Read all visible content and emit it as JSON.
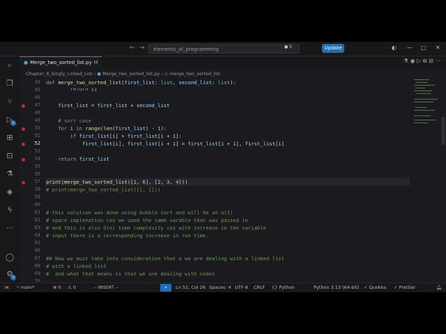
{
  "titlebar": {
    "search_text": "elements_of_programming",
    "search_extra": "● 5",
    "update_label": "Update"
  },
  "tab": {
    "label": "Merge_two_sorted_list.py",
    "modified_marker": "M",
    "close": "×"
  },
  "breadcrumbs": {
    "folder": "Chapter_8_Singly_Linked_List",
    "file": "Merge_two_sorted_list.py",
    "symbol": "merge_two_sorted_list"
  },
  "code": [
    {
      "num": "38",
      "text": ""
    },
    {
      "num": "45",
      "text": ""
    },
    {
      "num": "46",
      "text": ""
    },
    {
      "num": "47",
      "text": ""
    },
    {
      "num": "48",
      "text": ""
    },
    {
      "num": "49",
      "text": ""
    },
    {
      "num": "50",
      "text": ""
    },
    {
      "num": "51",
      "text": ""
    },
    {
      "num": "52",
      "text": ""
    },
    {
      "num": "53",
      "text": ""
    },
    {
      "num": "54",
      "text": ""
    },
    {
      "num": "55",
      "text": ""
    },
    {
      "num": "56",
      "text": ""
    },
    {
      "num": "57",
      "text": ""
    },
    {
      "num": "58",
      "text": "# print(merge_two_sorted_list([], []))"
    },
    {
      "num": "59",
      "text": ""
    },
    {
      "num": "60",
      "text": ""
    },
    {
      "num": "61",
      "text": "# this solution was done using bubble sort and will be an o(1)"
    },
    {
      "num": "62",
      "text": "# space implenation coz we used the same varable that was passed in"
    },
    {
      "num": "63",
      "text": "# and this is also O(n) time complexity coz with increase in the variable"
    },
    {
      "num": "64",
      "text": "# input there is a corresponding increase in run time."
    },
    {
      "num": "65",
      "text": ""
    },
    {
      "num": "66",
      "text": ""
    },
    {
      "num": "67",
      "text": "## Now we must take into consideration that a we are dealing with a linked list"
    },
    {
      "num": "68",
      "text": "# with a linked list"
    },
    {
      "num": "69",
      "text": "#  and what that means is that we are dealing with nodes"
    },
    {
      "num": "70",
      "text": ""
    }
  ],
  "status": {
    "branch": "main*",
    "errors": "⊗ 0",
    "warnings": "⚠ 0",
    "mode": "-- INSERT --",
    "position": "Ln 52, Col 26",
    "spaces": "Spaces: 4",
    "encoding": "UTF-8",
    "eol": "CRLF",
    "language": "Python",
    "interpreter": "Python 3.13 (64-bit)",
    "quokka": "Quokka",
    "prettier": "Prettier"
  },
  "icons": {
    "explorer": "files-icon",
    "search": "search-icon",
    "source_control": "source-control-icon",
    "run_debug": "run-debug-icon",
    "extensions": "extensions-icon",
    "testing": "flask-icon",
    "accounts": "account-icon",
    "settings": "gear-icon"
  },
  "colors": {
    "accent": "#1e6fb9",
    "breakpoint": "#c92a2a"
  }
}
